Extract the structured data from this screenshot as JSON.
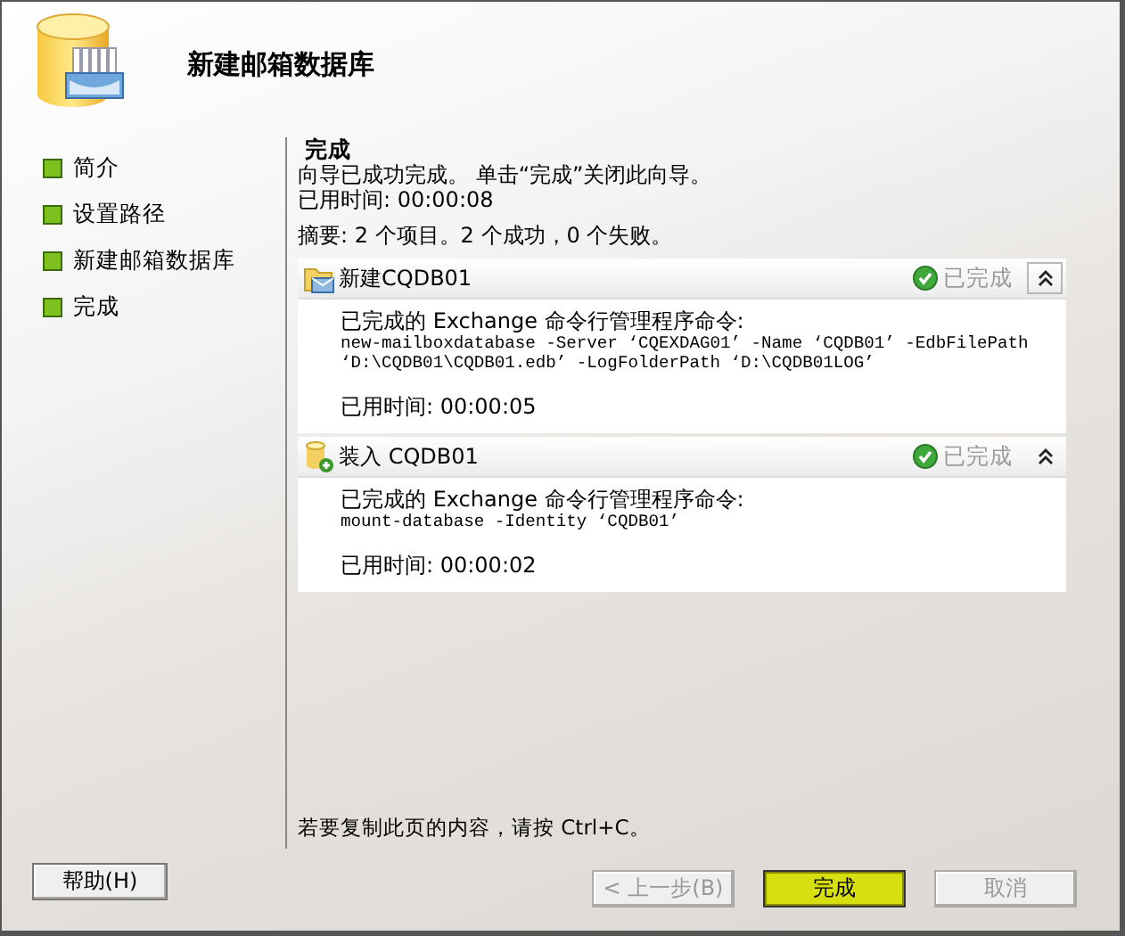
{
  "wizard": {
    "title": "新建邮箱数据库"
  },
  "nav": [
    {
      "label": "简介"
    },
    {
      "label": "设置路径"
    },
    {
      "label": "新建邮箱数据库"
    },
    {
      "label": "完成"
    }
  ],
  "page": {
    "heading": "完成",
    "message": "向导已成功完成。 单击“完成”关闭此向导。",
    "elapsed": "已用时间: 00:00:08",
    "summary": "摘要: 2 个项目。2 个成功，0 个失败。"
  },
  "tasks": [
    {
      "kind": "new",
      "title": "新建CQDB01",
      "status": "已完成",
      "expanded": true,
      "focused": true,
      "intro": "已完成的 Exchange 命令行管理程序命令:",
      "command_lines": [
        "new-mailboxdatabase -Server ‘CQEXDAG01’ -Name ‘CQDB01’ -EdbFilePath",
        "‘D:\\CQDB01\\CQDB01.edb’ -LogFolderPath ‘D:\\CQDB01LOG’"
      ],
      "elapsed": "已用时间: 00:00:05"
    },
    {
      "kind": "mount",
      "title": "装入 CQDB01",
      "status": "已完成",
      "expanded": true,
      "focused": false,
      "intro": "已完成的 Exchange 命令行管理程序命令:",
      "command_lines": [
        "mount-database -Identity ‘CQDB01’"
      ],
      "elapsed": "已用时间: 00:00:02"
    }
  ],
  "hint": "若要复制此页的内容，请按 Ctrl+C。",
  "help_button": {
    "label": "帮助(H)"
  },
  "buttons": [
    {
      "label": "< 上一步(B)",
      "disabled": true,
      "highlighted": false
    },
    {
      "label": "完成",
      "disabled": false,
      "highlighted": true
    },
    {
      "label": "取消",
      "disabled": true,
      "highlighted": false
    }
  ]
}
